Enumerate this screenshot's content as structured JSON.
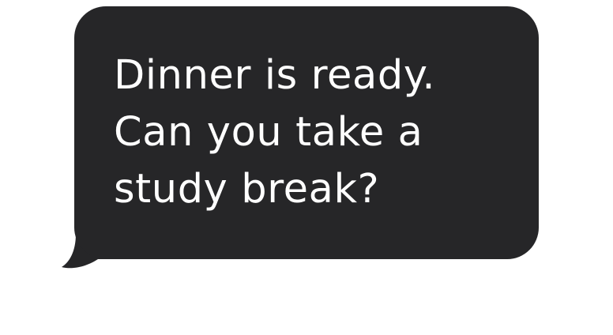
{
  "message": {
    "text": "Dinner is ready.\nCan you take a\nstudy break?",
    "direction": "received"
  },
  "colors": {
    "bubble_background": "#262628",
    "text": "#ffffff",
    "page_background": "#ffffff"
  }
}
